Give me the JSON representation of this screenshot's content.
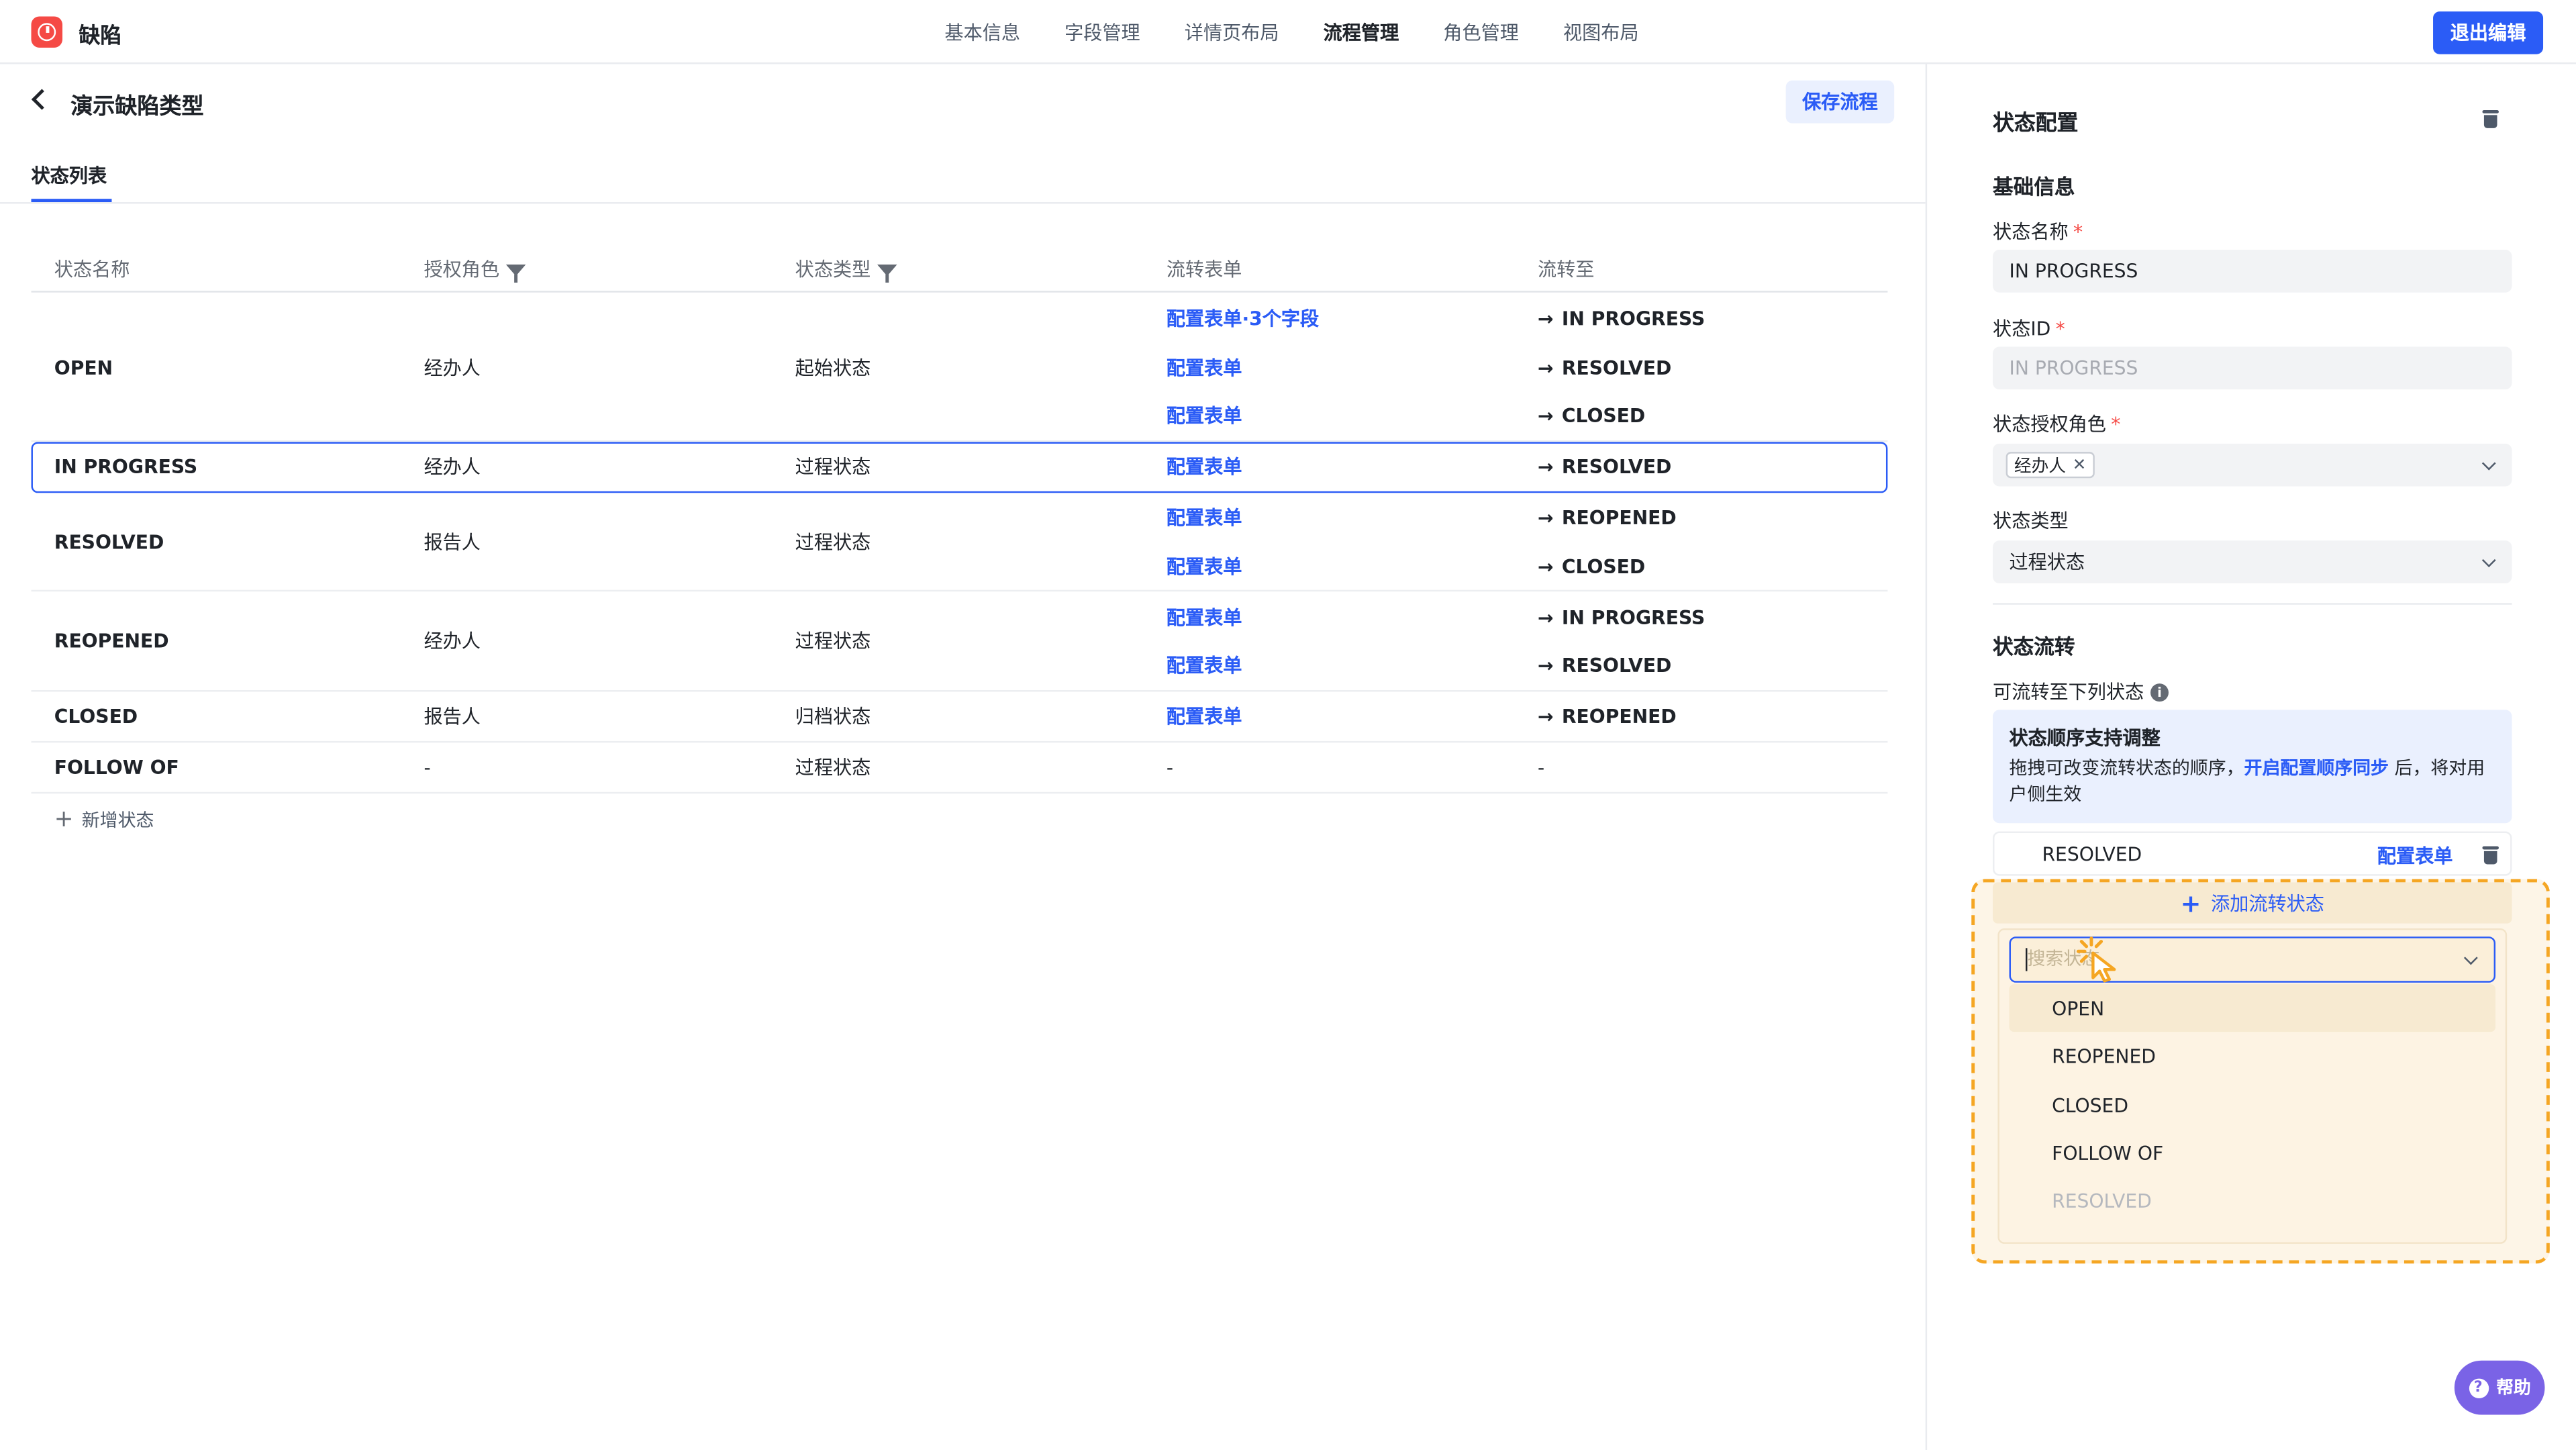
{
  "app": {
    "title": "缺陷"
  },
  "nav": {
    "items": [
      "基本信息",
      "字段管理",
      "详情页布局",
      "流程管理",
      "角色管理",
      "视图布局"
    ],
    "active": "流程管理",
    "exit_label": "退出编辑"
  },
  "page": {
    "title": "演示缺陷类型",
    "save_label": "保存流程",
    "tab": "状态列表"
  },
  "table": {
    "headers": [
      "状态名称",
      "授权角色",
      "状态类型",
      "流转表单",
      "流转至"
    ],
    "rows": [
      {
        "name": "OPEN",
        "role": "经办人",
        "type": "起始状态",
        "forms": [
          "配置表单·3个字段",
          "配置表单",
          "配置表单"
        ],
        "targets": [
          "IN PROGRESS",
          "RESOLVED",
          "CLOSED"
        ]
      },
      {
        "name": "IN PROGRESS",
        "role": "经办人",
        "type": "过程状态",
        "forms": [
          "配置表单"
        ],
        "targets": [
          "RESOLVED"
        ],
        "selected": true
      },
      {
        "name": "RESOLVED",
        "role": "报告人",
        "type": "过程状态",
        "forms": [
          "配置表单",
          "配置表单"
        ],
        "targets": [
          "REOPENED",
          "CLOSED"
        ]
      },
      {
        "name": "REOPENED",
        "role": "经办人",
        "type": "过程状态",
        "forms": [
          "配置表单",
          "配置表单"
        ],
        "targets": [
          "IN PROGRESS",
          "RESOLVED"
        ]
      },
      {
        "name": "CLOSED",
        "role": "报告人",
        "type": "归档状态",
        "forms": [
          "配置表单"
        ],
        "targets": [
          "REOPENED"
        ]
      },
      {
        "name": "FOLLOW OF",
        "role": "-",
        "type": "过程状态",
        "forms": [
          "-"
        ],
        "targets": [
          "-"
        ],
        "plain": true
      }
    ],
    "add_label": "新增状态"
  },
  "panel": {
    "title": "状态配置",
    "basic_title": "基础信息",
    "name_label": "状态名称",
    "name_value": "IN PROGRESS",
    "id_label": "状态ID",
    "id_value": "IN PROGRESS",
    "role_label": "状态授权角色",
    "role_tag": "经办人",
    "type_label": "状态类型",
    "type_value": "过程状态",
    "flow_title": "状态流转",
    "flow_label": "可流转至下列状态",
    "notice_title": "状态顺序支持调整",
    "notice_body_1": "拖拽可改变流转状态的顺序，",
    "notice_link": "开启配置顺序同步",
    "notice_body_2": " 后，将对用户侧生效",
    "existing_name": "RESOLVED",
    "existing_link": "配置表单",
    "add_transition": "添加流转状态",
    "search_placeholder": "搜索状态",
    "options": [
      {
        "label": "OPEN",
        "hover": true
      },
      {
        "label": "REOPENED"
      },
      {
        "label": "CLOSED"
      },
      {
        "label": "FOLLOW OF"
      },
      {
        "label": "RESOLVED",
        "disabled": true
      }
    ]
  },
  "help": {
    "label": "帮助"
  },
  "colors": {
    "primary": "#2b5cf6",
    "highlight": "#f5a623",
    "danger": "#f54a45",
    "help": "#7a63e6"
  }
}
